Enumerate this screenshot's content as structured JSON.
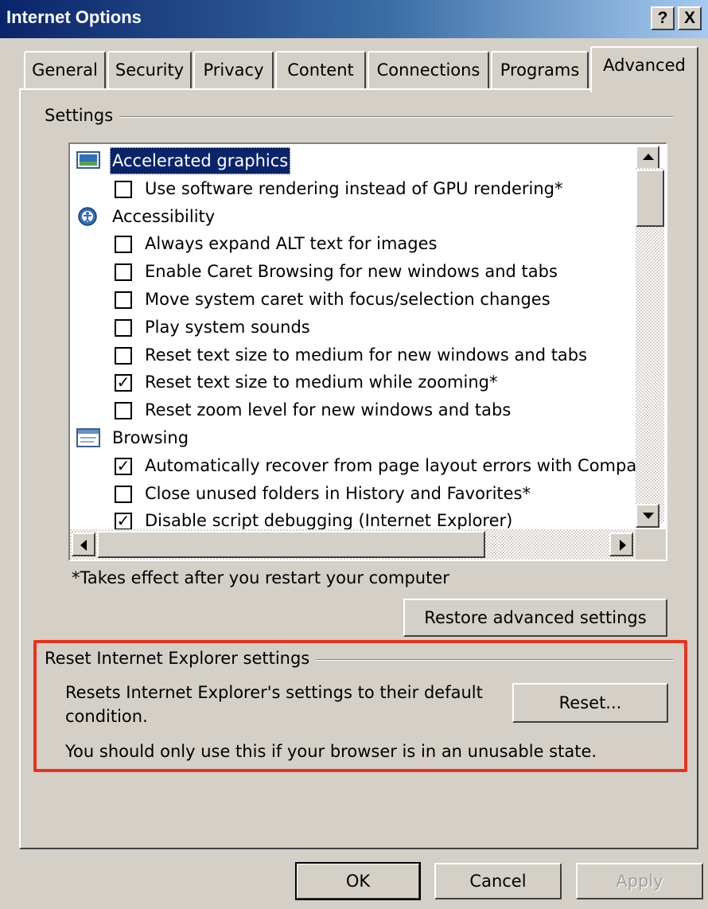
{
  "window": {
    "title": "Internet Options",
    "help_glyph": "?",
    "close_glyph": "X"
  },
  "tabs": [
    {
      "label": "General"
    },
    {
      "label": "Security"
    },
    {
      "label": "Privacy"
    },
    {
      "label": "Content"
    },
    {
      "label": "Connections"
    },
    {
      "label": "Programs"
    },
    {
      "label": "Advanced"
    }
  ],
  "settings": {
    "group_label": "Settings",
    "items": [
      {
        "type": "category",
        "icon": "monitor-icon",
        "label": "Accelerated graphics",
        "selected": true
      },
      {
        "type": "option",
        "label": "Use software rendering instead of GPU rendering*",
        "checked": false
      },
      {
        "type": "category",
        "icon": "accessibility-icon",
        "label": "Accessibility"
      },
      {
        "type": "option",
        "label": "Always expand ALT text for images",
        "checked": false
      },
      {
        "type": "option",
        "label": "Enable Caret Browsing for new windows and tabs",
        "checked": false
      },
      {
        "type": "option",
        "label": "Move system caret with focus/selection changes",
        "checked": false
      },
      {
        "type": "option",
        "label": "Play system sounds",
        "checked": false
      },
      {
        "type": "option",
        "label": "Reset text size to medium for new windows and tabs",
        "checked": false
      },
      {
        "type": "option",
        "label": "Reset text size to medium while zooming*",
        "checked": true
      },
      {
        "type": "option",
        "label": "Reset zoom level for new windows and tabs",
        "checked": false
      },
      {
        "type": "category",
        "icon": "browser-window-icon",
        "label": "Browsing"
      },
      {
        "type": "option",
        "label": "Automatically recover from page layout errors with Compa",
        "checked": true
      },
      {
        "type": "option",
        "label": "Close unused folders in History and Favorites*",
        "checked": false
      },
      {
        "type": "option",
        "label": "Disable script debugging (Internet Explorer)",
        "checked": true
      }
    ],
    "check_glyph": "✓",
    "footnote": "*Takes effect after you restart your computer",
    "restore_button": "Restore advanced settings"
  },
  "reset_section": {
    "group_label": "Reset Internet Explorer settings",
    "description_line1": "Resets Internet Explorer's settings to their default",
    "description_line2": "condition.",
    "warning": "You should only use this if your browser is in an unusable state.",
    "reset_button": "Reset..."
  },
  "footer": {
    "ok": "OK",
    "cancel": "Cancel",
    "apply": "Apply"
  },
  "colors": {
    "title_bar": "#0a246a",
    "highlight_border": "#e8331c",
    "selection": "#0a246a"
  }
}
